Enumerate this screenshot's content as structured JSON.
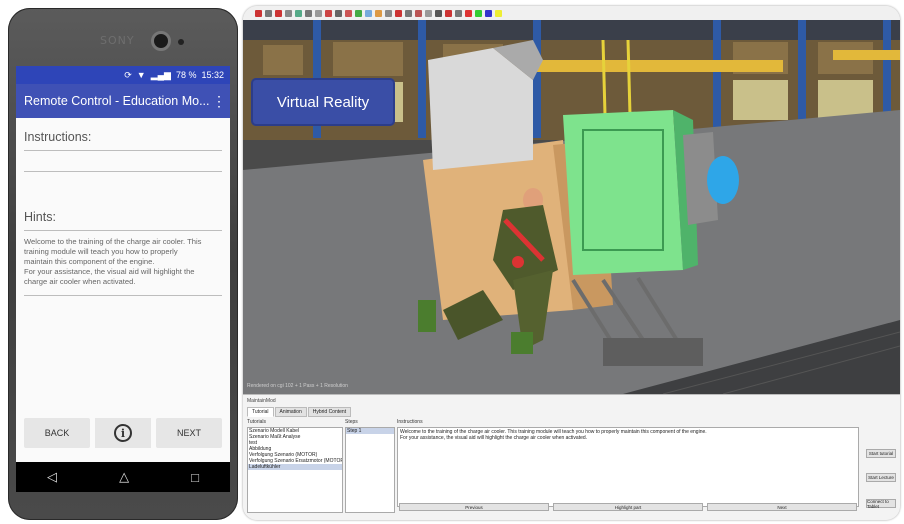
{
  "phone": {
    "brand": "SONY",
    "status": {
      "time": "15:32",
      "battery": "78 %"
    },
    "app_title": "Remote Control - Education Mo...",
    "instructions_label": "Instructions:",
    "hints_label": "Hints:",
    "hint_lines": [
      "Welcome to the training of the charge air cooler. This",
      "training module will teach you how to properly",
      "maintain this component of the engine.",
      "For your assistance, the visual aid will highlight the",
      "charge air cooler when activated."
    ],
    "back_label": "BACK",
    "info_label": "i",
    "next_label": "NEXT",
    "nav": {
      "back": "◁",
      "home": "△",
      "recent": "□"
    }
  },
  "desktop": {
    "vr_label": "Virtual Reality",
    "viewport_caption": "Rendered on cgi 102 + 1 Pass + 1 Resolution",
    "panel_title": "MaintainMod",
    "tabs": [
      "Tutorial",
      "Animation",
      "Hybrid Content"
    ],
    "col_tutorials": "Tutorials",
    "tutorials": [
      "Szenario Modell Kabel",
      "Szenario Maßt Analyse",
      "test",
      "Abbildung",
      "Verfolgung Szenario (MOTOR)",
      "Verfolgung Szenario Ersatzmotor (MOTOR)",
      "Ladeluftkühler"
    ],
    "col_steps": "Steps",
    "steps": [
      "Step 1"
    ],
    "col_instructions": "Instructions",
    "instruction_lines": [
      "Welcome to the training of the charge air cooler. This training module will teach you how to properly maintain this component of the engine.",
      "For your assistance, the visual aid will highlight the charge air cooler when activated."
    ],
    "right_buttons": [
      "Start tutorial",
      "Start Lecture",
      "Connect to Tablet"
    ],
    "bottom_buttons": [
      "Previous",
      "Highlight part",
      "Next"
    ]
  }
}
